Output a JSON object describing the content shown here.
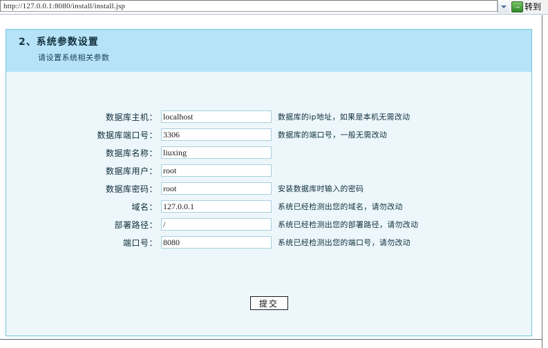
{
  "browser": {
    "url": "http://127.0.0.1:8080/install/install.jsp",
    "url_placeholder": "",
    "dropdown_icon": "chevron-down-icon",
    "go_icon": "green-arrow-icon",
    "go_glyph": "→",
    "go_label": "转到"
  },
  "panel": {
    "title": "2、系统参数设置",
    "subtitle": "请设置系统相关参数",
    "header_bg": "#b6e3f7",
    "border_color": "#6fc5dd",
    "body_bg": "#edf7fb"
  },
  "form": {
    "fields": [
      {
        "label": "数据库主机：",
        "value": "localhost",
        "placeholder": "",
        "hint": "数据库的ip地址，如果是本机无需改动",
        "name": "db-host"
      },
      {
        "label": "数据库端口号：",
        "value": "3306",
        "placeholder": "",
        "hint": "数据库的端口号，一般无需改动",
        "name": "db-port"
      },
      {
        "label": "数据库名称：",
        "value": "liuxing",
        "placeholder": "",
        "hint": "",
        "name": "db-name"
      },
      {
        "label": "数据库用户：",
        "value": "root",
        "placeholder": "",
        "hint": "",
        "name": "db-user"
      },
      {
        "label": "数据库密码：",
        "value": "root",
        "placeholder": "",
        "hint": "安装数据库时输入的密码",
        "name": "db-password"
      },
      {
        "label": "域名：",
        "value": "127.0.0.1",
        "placeholder": "",
        "hint": "系统已经检测出您的域名，请勿改动",
        "name": "domain"
      },
      {
        "label": "部署路径：",
        "value": "/",
        "placeholder": "",
        "hint": "系统已经检测出您的部署路径，请勿改动",
        "name": "deploy-path"
      },
      {
        "label": "端口号：",
        "value": "8080",
        "placeholder": "",
        "hint": "系统已经检测出您的端口号，请勿改动",
        "name": "port"
      }
    ],
    "submit_label": "提交"
  },
  "footer": {
    "text": ""
  }
}
